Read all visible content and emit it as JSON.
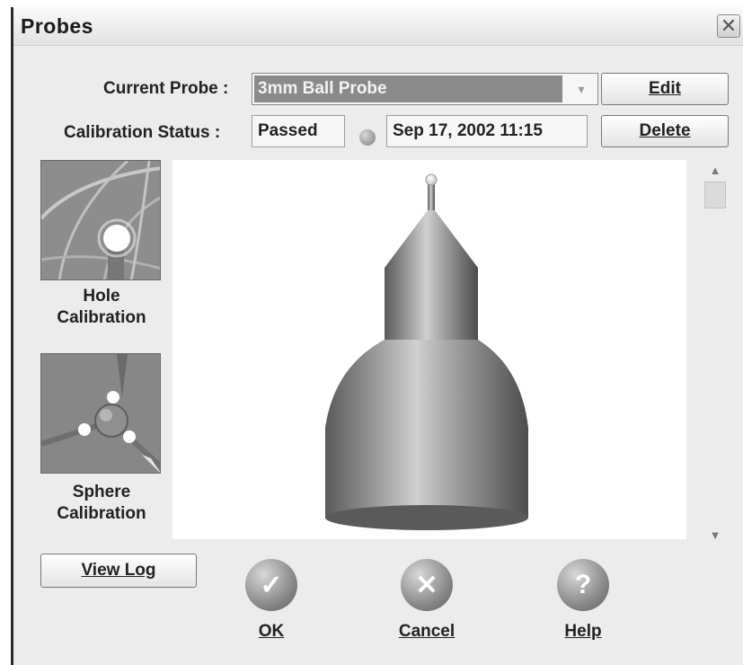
{
  "window": {
    "title": "Probes",
    "close_glyph": "✕"
  },
  "current_probe": {
    "label": "Current Probe :",
    "value": "3mm Ball Probe",
    "arrow": "▾"
  },
  "calibration": {
    "label": "Calibration Status :",
    "status": "Passed",
    "timestamp": "Sep 17, 2002 11:15",
    "status_indicator_color": "#9a9a9a"
  },
  "actions": {
    "edit_label": "Edit",
    "delete_label": "Delete",
    "view_log_label": "View Log"
  },
  "sidebar": {
    "items": [
      {
        "label_line1": "Hole",
        "label_line2": "Calibration",
        "icon": "hole-calibration-icon"
      },
      {
        "label_line1": "Sphere",
        "label_line2": "Calibration",
        "icon": "sphere-calibration-icon"
      }
    ]
  },
  "scrollbar": {
    "up": "▲",
    "down": "▼"
  },
  "footer": {
    "ok_label": "OK",
    "ok_glyph": "✓",
    "cancel_label": "Cancel",
    "cancel_glyph": "✕",
    "help_label": "Help",
    "help_glyph": "?"
  },
  "colors": {
    "dialog_bg": "#ececec",
    "selection_bg": "#8a8a8a"
  }
}
